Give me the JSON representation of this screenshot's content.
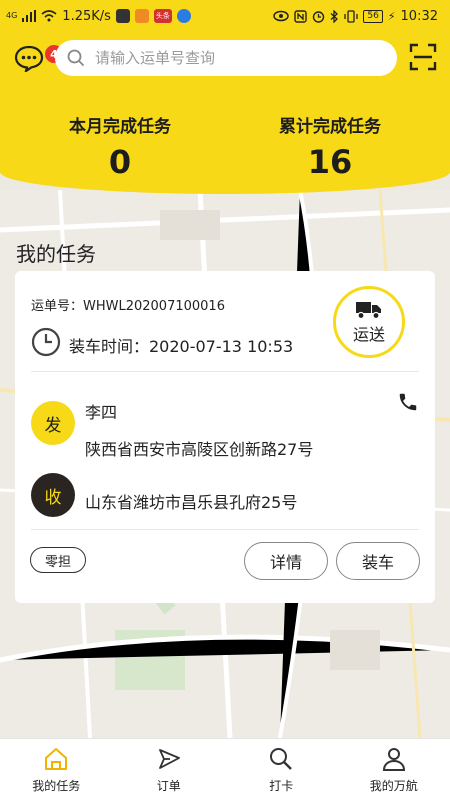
{
  "status_bar": {
    "network": "4G",
    "speed": "1.25K/s",
    "badge_app": "头条",
    "battery": "56",
    "time": "10:32"
  },
  "header": {
    "message_badge": "4",
    "search_placeholder": "请输入运单号查询"
  },
  "stats": {
    "month_label": "本月完成任务",
    "month_value": "0",
    "total_label": "累计完成任务",
    "total_value": "16"
  },
  "section_title": "我的任务",
  "task": {
    "waybill": "运单号：WHWL202007100016",
    "load_time": "装车时间：2020-07-13 10:53",
    "status": "运送",
    "sender_role": "发",
    "sender_name": "李四",
    "sender_address": "陕西省西安市高陵区创新路27号",
    "receiver_role": "收",
    "receiver_address": "山东省潍坊市昌乐县孔府25号",
    "tag": "零担",
    "detail_button": "详情",
    "load_button": "装车"
  },
  "tabs": [
    {
      "label": "我的任务",
      "icon": "home-icon",
      "active": true
    },
    {
      "label": "订单",
      "icon": "send-icon",
      "active": false
    },
    {
      "label": "打卡",
      "icon": "search-icon",
      "active": false
    },
    {
      "label": "我的万航",
      "icon": "user-icon",
      "active": false
    }
  ],
  "colors": {
    "accent": "#f7d918",
    "badge": "#e8362d",
    "dark": "#2a2520"
  }
}
